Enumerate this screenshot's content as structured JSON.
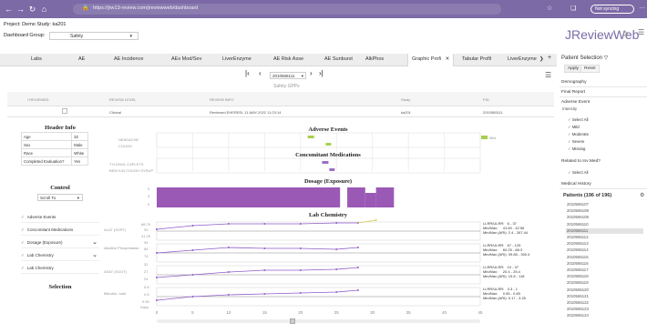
{
  "browser": {
    "url": "https://jrw13-review.com/jreviewweb/dashboard",
    "profile_button": "Not syncing"
  },
  "header": {
    "project_label": "Project: Demo  Study: ka201",
    "dashboard_group_label": "Dashboard Group:",
    "dashboard_group_value": "Safety",
    "brand": "JReviewWeb"
  },
  "tabs": [
    {
      "label": "Labs"
    },
    {
      "label": "AE"
    },
    {
      "label": "AE Incidence"
    },
    {
      "label": "AEs Mod/Sev"
    },
    {
      "label": "LiverEnzyme"
    },
    {
      "label": "AE Risk Asse"
    },
    {
      "label": "AE Sunburst"
    },
    {
      "label": "AlkPhos"
    },
    {
      "label": "Graphic Profi"
    },
    {
      "label": "Tabular Profil"
    },
    {
      "label": "LiverEnzyme"
    }
  ],
  "pager": {
    "patient": "2010565111"
  },
  "report": {
    "title": "Safety GPPs",
    "columns": [
      "I REVIEWED",
      "REVIEW LEVEL",
      "REVIEW INFO",
      "Study",
      "PID"
    ],
    "row": [
      "Clinical",
      "Reviewed EHEREEL 11-MAY-2022 11:23:14",
      "ka201",
      "2010565111"
    ]
  },
  "header_info": {
    "title": "Header Info",
    "rows": [
      {
        "k": "Age",
        "v": "32"
      },
      {
        "k": "Sex",
        "v": "Male"
      },
      {
        "k": "Race",
        "v": "White"
      },
      {
        "k": "Completed Evaluation?",
        "v": "Yes"
      }
    ]
  },
  "control": {
    "title": "Control",
    "scroll_to": "Scroll To",
    "items": [
      {
        "label": "Adverse Events"
      },
      {
        "label": "Concomitant Medications"
      },
      {
        "label": "Dosage (Exposure)"
      },
      {
        "label": "Lab Chemistry"
      },
      {
        "label": "Lab Chemistry"
      }
    ]
  },
  "selection": {
    "title": "Selection"
  },
  "sections": {
    "ae": "Adverse Events",
    "ae_rows": [
      "HEADACHE",
      "COUGH"
    ],
    "ae_legend": "Mild",
    "cm": "Concomitant Medications",
    "cm_rows": [
      "TYLENOL CAPLETS",
      "BENYLIN COUGH SYRUP"
    ],
    "dosage": "Dosage (Exposure)",
    "dosage_ticks": [
      "5",
      "3",
      "0"
    ],
    "lab": "Lab Chemistry"
  },
  "lab_tests": [
    {
      "name": "ALAT (SGPT)",
      "ticks": [
        "68.79",
        "30",
        "41.25"
      ],
      "stats": "LLRR/ULRR:   6 - 37\nMin/Max:     41.60 - 42.56\nMin/Max (ARI): 2.4 - 267.44"
    },
    {
      "name": "Alkaline Phosphatase",
      "ticks": [
        "94",
        "84",
        "74"
      ],
      "stats": "LLRR/ULRR:   67 - 125\nMin/Max:     60.25 - 88.3\nMin/Max (ARI): 39.85 - 300.4"
    },
    {
      "name": "ASAT (SGOT)",
      "ticks": [
        "32",
        "27",
        "24"
      ],
      "stats": "LLRR/ULRR:   10 - 37\nMin/Max:     20.4 - 25.4\nMin/Max (ARI): 19.8 - 118"
    },
    {
      "name": "Bilirubin, total",
      "ticks": [
        "5.8",
        "0.8",
        "0.55"
      ],
      "stats": "LLRR/ULRR:   3.3 - 1\nMin/Max:     0.55 - 0.83\nMin/Max (ARI): 0.17 - 3.25"
    }
  ],
  "x_axis": {
    "label": "Days",
    "ticks": [
      "0",
      "5",
      "10",
      "15",
      "20",
      "25",
      "30",
      "35",
      "40",
      "45"
    ]
  },
  "right_panel": {
    "title": "Patient Selection",
    "apply": "Apply",
    "reset": "Reset",
    "sections": [
      "Demography",
      "Final Report",
      "Adverse Event",
      "Related to Inv Med?",
      "Medical History"
    ],
    "ae_intensity": "Intensity",
    "ae_options": [
      "Select All",
      "Mild",
      "Moderate",
      "Severe",
      "Missing"
    ],
    "related_option": "Select All",
    "patients_title": "Patients (196 of 196)",
    "patients": [
      "2010565107",
      "2010565108",
      "2010565109",
      "2010565110",
      "2010565111",
      "2010565112",
      "2010565113",
      "2010565114",
      "2010565115",
      "2010565116",
      "2010565117",
      "2010565118",
      "2010565119",
      "2010565120",
      "2010565121",
      "2010565122",
      "2010565123",
      "2010565124"
    ],
    "selected_patient": "2010565111"
  },
  "colors": {
    "accent": "#7b6aa6",
    "dosage": "#9b59b6",
    "ae_mild": "#a6d04b",
    "lab_line": "#8e5bc7"
  }
}
